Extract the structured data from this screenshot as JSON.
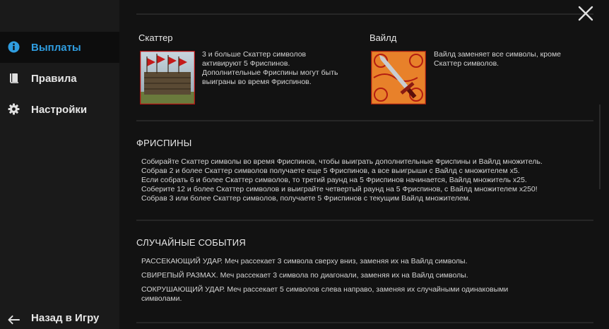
{
  "sidebar": {
    "items": [
      {
        "label": "Выплаты",
        "icon": "info-icon",
        "active": true
      },
      {
        "label": "Правила",
        "icon": "book-icon",
        "active": false
      },
      {
        "label": "Настройки",
        "icon": "gear-icon",
        "active": false
      }
    ],
    "back_label": "Назад в Игру",
    "back_icon": "arrow-left-icon"
  },
  "symbols": {
    "scatter": {
      "title": "Скаттер",
      "lines": [
        "3 и больше Скаттер символов",
        "активируют 5 Фриспинов.",
        "Дополнительные Фриспины могут быть",
        "выиграны во время Фриспинов."
      ]
    },
    "wild": {
      "title": "Вайлд",
      "lines": [
        "Вайлд заменяет все символы, кроме",
        "Скаттер символов."
      ]
    }
  },
  "freespins": {
    "title": "ФРИСПИНЫ",
    "lines": [
      "Собирайте Скаттер символы во время Фриспинов, чтобы выиграть дополнительные Фриспины и Вайлд множитель.",
      "Собрав 2 и более Скаттер символов получаете еще 5 Фриспинов, а все выигрыши с Вайлд с множителем x5.",
      "Если собрать 6 и более Скаттер символов, то третий раунд на 5 Фриспинов начинается, Вайлд множитель x25.",
      "Соберите 12 и более Скаттер символов и выиграйте четвертый раунд на 5 Фриспинов, с Вайлд множителем x250!",
      "Собрав 3 или более Скаттер символов, получаете 5 Фриспинов с текущим Вайлд множителем."
    ]
  },
  "events": {
    "title": "СЛУЧАЙНЫЕ СОБЫТИЯ",
    "lines": [
      "РАССЕКАЮЩИЙ УДАР. Меч рассекает 3 символа сверху вниз, заменяя их на Вайлд символы.",
      "СВИРЕПЫЙ РАЗМАХ. Меч рассекает 3 символа по диагонали, заменяя их на Вайлд символы.",
      "СОКРУШАЮЩИЙ УДАР. Меч рассекает 5 символов слева направо, заменяя их случайными одинаковыми",
      "символами."
    ]
  },
  "colors": {
    "accent": "#2f9de0",
    "background": "#121212",
    "sidebar": "#1a1a1a"
  },
  "close_icon": "close-icon"
}
